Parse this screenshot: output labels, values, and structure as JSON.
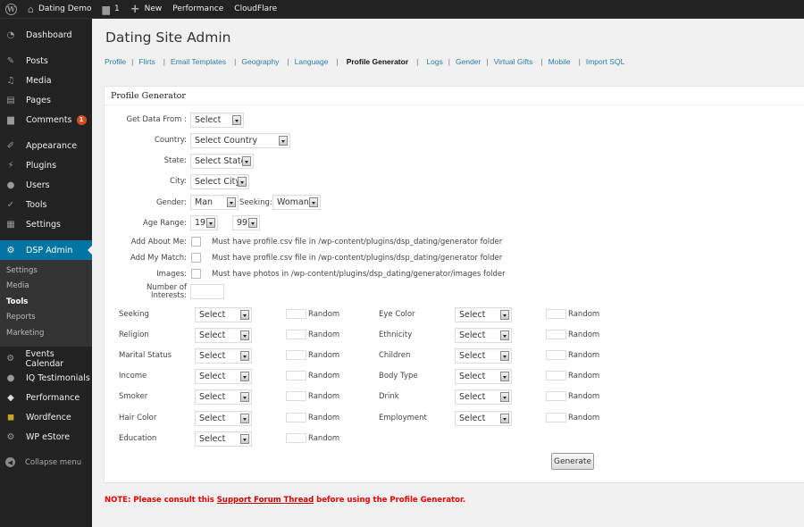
{
  "adminbar": {
    "site_name": "Dating Demo",
    "comments_count": "1",
    "new_label": "New",
    "performance_label": "Performance",
    "cloudflare_label": "CloudFlare"
  },
  "sidebar": {
    "items": [
      {
        "label": "Dashboard",
        "icon": "dashboard-icon"
      },
      {
        "label": "Posts",
        "icon": "pin-icon"
      },
      {
        "label": "Media",
        "icon": "media-icon"
      },
      {
        "label": "Pages",
        "icon": "pages-icon"
      },
      {
        "label": "Comments",
        "icon": "comment-icon",
        "badge": "1"
      },
      {
        "label": "Appearance",
        "icon": "brush-icon"
      },
      {
        "label": "Plugins",
        "icon": "plug-icon"
      },
      {
        "label": "Users",
        "icon": "user-icon"
      },
      {
        "label": "Tools",
        "icon": "wrench-icon"
      },
      {
        "label": "Settings",
        "icon": "settings-icon"
      },
      {
        "label": "DSP Admin",
        "icon": "gear-icon"
      }
    ],
    "submenu": [
      "Settings",
      "Media",
      "Tools",
      "Reports",
      "Marketing"
    ],
    "submenu_current": "Tools",
    "items_after": [
      {
        "label": "Events Calendar",
        "icon": "gear-icon"
      },
      {
        "label": "IQ Testimonials",
        "icon": "speech-bubble-icon"
      },
      {
        "label": "Performance",
        "icon": "performance-icon"
      },
      {
        "label": "Wordfence",
        "icon": "shield-icon"
      },
      {
        "label": "WP eStore",
        "icon": "gear-icon"
      }
    ],
    "collapse_label": "Collapse menu"
  },
  "page": {
    "title": "Dating Site Admin",
    "subnav": [
      "Profile",
      "Flirts",
      "Email Templates",
      "Geography",
      "Language",
      "Profile Generator",
      "Logs",
      "Gender",
      "Virtual Gifts",
      "Mobile",
      "Import SQL"
    ],
    "subnav_current": "Profile Generator"
  },
  "form": {
    "box_title": "Profile Generator",
    "get_data_from": {
      "label": "Get Data From :",
      "value": "Select"
    },
    "country": {
      "label": "Country:",
      "value": "Select Country"
    },
    "state": {
      "label": "State:",
      "value": "Select State"
    },
    "city": {
      "label": "City:",
      "value": "Select City"
    },
    "gender": {
      "label": "Gender:",
      "value": "Man"
    },
    "seeking": {
      "label": "Seeking:",
      "value": "Woman"
    },
    "age_range": {
      "label": "Age Range:",
      "from": "19",
      "to": "99"
    },
    "add_about_me": {
      "label": "Add About Me:",
      "note": "Must have profile.csv file in /wp-content/plugins/dsp_dating/generator folder"
    },
    "add_my_match": {
      "label": "Add My Match:",
      "note": "Must have profile.csv file in /wp-content/plugins/dsp_dating/generator folder"
    },
    "images": {
      "label": "Images:",
      "note": "Must have photos in /wp-content/plugins/dsp_dating/generator/images folder"
    },
    "interests": {
      "label_line1": "Number of",
      "label_line2": "Interests:",
      "value": ""
    },
    "random_label": "Random",
    "left_fields": [
      {
        "label": "Seeking",
        "value": "Select"
      },
      {
        "label": "Religion",
        "value": "Select"
      },
      {
        "label": "Marital Status",
        "value": "Select"
      },
      {
        "label": "Income",
        "value": "Select"
      },
      {
        "label": "Smoker",
        "value": "Select"
      },
      {
        "label": "Hair Color",
        "value": "Select"
      },
      {
        "label": "Education",
        "value": "Select"
      }
    ],
    "right_fields": [
      {
        "label": "Eye Color",
        "value": "Select"
      },
      {
        "label": "Ethnicity",
        "value": "Select"
      },
      {
        "label": "Children",
        "value": "Select"
      },
      {
        "label": "Body Type",
        "value": "Select"
      },
      {
        "label": "Drink",
        "value": "Select"
      },
      {
        "label": "Employment",
        "value": "Select"
      }
    ],
    "generate_label": "Generate"
  },
  "warning": {
    "prefix": "NOTE: Please consult this ",
    "link": "Support Forum Thread",
    "suffix": " before using the Profile Generator."
  }
}
